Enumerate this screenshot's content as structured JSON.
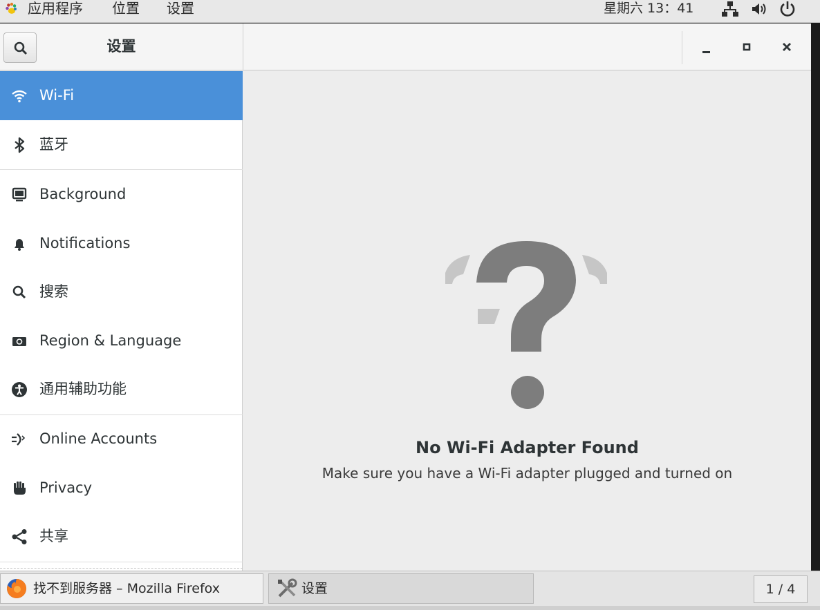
{
  "topbar": {
    "menus": [
      "应用程序",
      "位置",
      "设置"
    ],
    "clock": "星期六 13：41",
    "icons": [
      "gnome-foot-icon",
      "network-wired-icon",
      "volume-icon",
      "power-icon"
    ]
  },
  "window": {
    "title": "设置",
    "controls": [
      "minimize-icon",
      "maximize-icon",
      "close-icon"
    ]
  },
  "sidebar": {
    "items": [
      {
        "label": "Wi-Fi",
        "icon": "wifi-icon",
        "active": true
      },
      {
        "label": "蓝牙",
        "icon": "bluetooth-icon"
      },
      {
        "label": "Background",
        "icon": "monitor-icon"
      },
      {
        "label": "Notifications",
        "icon": "bell-icon"
      },
      {
        "label": "搜索",
        "icon": "search-icon"
      },
      {
        "label": "Region & Language",
        "icon": "region-icon"
      },
      {
        "label": "通用辅助功能",
        "icon": "accessibility-icon"
      },
      {
        "label": "Online Accounts",
        "icon": "online-accounts-icon"
      },
      {
        "label": "Privacy",
        "icon": "hand-icon"
      },
      {
        "label": "共享",
        "icon": "share-icon"
      }
    ]
  },
  "content": {
    "heading": "No Wi-Fi Adapter Found",
    "message": "Make sure you have a Wi-Fi adapter plugged and turned on",
    "icon": "question-mark-icon"
  },
  "taskbar": {
    "tasks": [
      {
        "label": "找不到服务器 – Mozilla Firefox",
        "icon": "firefox-icon"
      },
      {
        "label": "设置",
        "icon": "settings-tools-icon"
      }
    ],
    "workspace": "1 / 4"
  },
  "colors": {
    "accent": "#4a90d9",
    "window_bg": "#ededed",
    "sidebar_bg": "#ffffff"
  }
}
